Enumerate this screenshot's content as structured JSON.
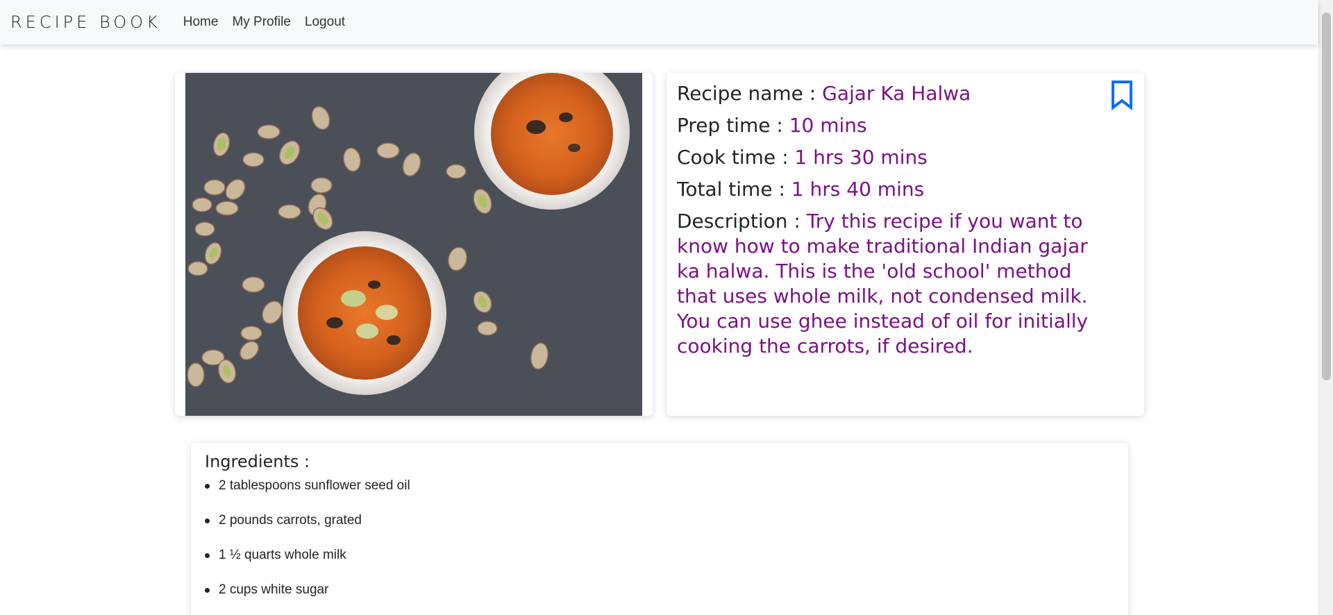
{
  "navbar": {
    "brand": "RECIPE BOOK",
    "links": [
      "Home",
      "My Profile",
      "Logout"
    ]
  },
  "recipe": {
    "image_alt": "Gajar Ka Halwa bowls with pistachios",
    "name_label": "Recipe name : ",
    "name": "Gajar Ka Halwa",
    "prep_label": "Prep time : ",
    "prep": "10 mins",
    "cook_label": "Cook time : ",
    "cook": "1 hrs 30 mins",
    "total_label": "Total time : ",
    "total": "1 hrs 40 mins",
    "description_label": "Description : ",
    "description": "Try this recipe if you want to know how to make traditional Indian gajar ka halwa. This is the 'old school' method that uses whole milk, not condensed milk. You can use ghee instead of oil for initially cooking the carrots, if desired."
  },
  "ingredients": {
    "title": "Ingredients :",
    "items": [
      "2 tablespoons sunflower seed oil",
      "2 pounds carrots, grated",
      "1 ½ quarts whole milk",
      "2 cups white sugar"
    ]
  },
  "colors": {
    "value_purple": "#7b1185",
    "bookmark_blue": "#0d6efd",
    "navbar_bg": "#f8f9fa"
  },
  "icons": {
    "bookmark": "bookmark-outline-icon"
  }
}
